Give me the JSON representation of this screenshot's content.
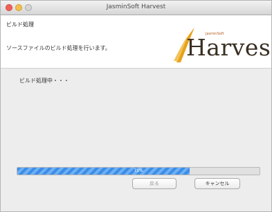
{
  "window": {
    "title": "JasminSoft Harvest"
  },
  "header": {
    "title": "ビルド処理",
    "subtitle": "ソースファイルのビルド処理を行います。"
  },
  "logo": {
    "text": "Harvest",
    "brand": "JasminSoft"
  },
  "status": {
    "text": "ビルド処理中・・・"
  },
  "progress": {
    "percent": 71,
    "label": "71%"
  },
  "buttons": {
    "back_label": "戻る",
    "cancel_label": "キャンセル"
  },
  "colors": {
    "progress_fill": "#3d8de6",
    "logo_gold": "#e8a21c"
  }
}
